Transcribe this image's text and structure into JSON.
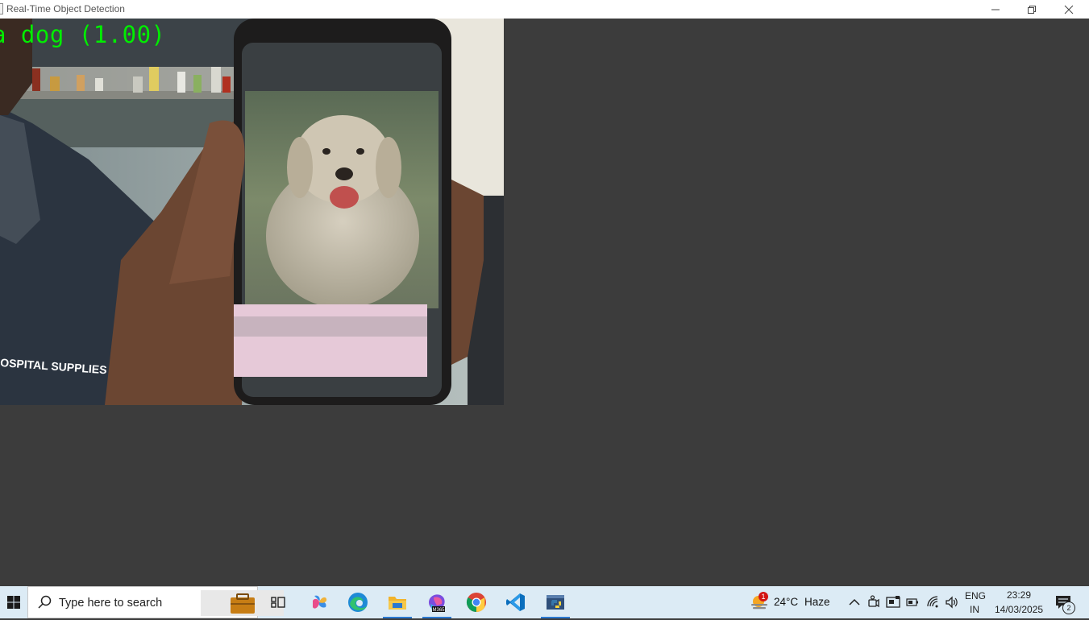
{
  "window": {
    "title": "Real-Time Object Detection",
    "controls": [
      "minimize",
      "restore",
      "close"
    ]
  },
  "camera": {
    "detection_label": "a dog (1.00)",
    "detection_color": "#00ee00",
    "shirt_text": "OSPITAL SUPPLIES"
  },
  "taskbar": {
    "search_placeholder": "Type here to search",
    "apps": [
      "task-view",
      "copilot",
      "edge",
      "file-explorer",
      "microsoft-365",
      "chrome",
      "vscode",
      "python"
    ],
    "weather": {
      "temp": "24°C",
      "condition": "Haze",
      "badge": "1"
    },
    "language": {
      "line1": "ENG",
      "line2": "IN"
    },
    "clock": {
      "time": "23:29",
      "date": "14/03/2025"
    },
    "notifications": {
      "count": "2"
    }
  }
}
